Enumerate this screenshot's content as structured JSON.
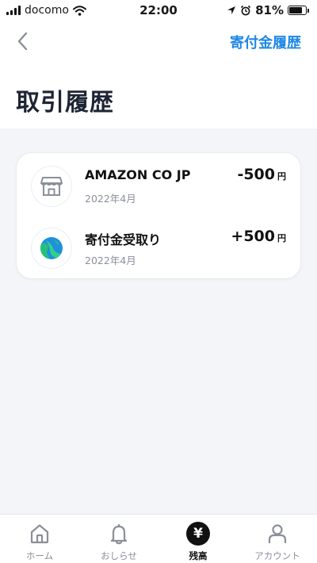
{
  "status_bar": {
    "carrier": "docomo",
    "time": "22:00",
    "battery": "81%",
    "battery_level": 0.81
  },
  "header": {
    "title": "取引履歴",
    "donation_link": "寄付金履歴"
  },
  "transactions": [
    {
      "name": "AMAZON CO JP",
      "date": "2022年4月",
      "amount": "-500",
      "unit": "円",
      "icon": "store-icon"
    },
    {
      "name": "寄付金受取り",
      "date": "2022年4月",
      "amount": "+500",
      "unit": "円",
      "icon": "globe-leaf-icon"
    }
  ],
  "tabs": [
    {
      "label": "ホーム",
      "icon": "home-icon"
    },
    {
      "label": "おしらせ",
      "icon": "bell-icon"
    },
    {
      "label": "残高",
      "icon": "yen-icon",
      "glyph": "¥",
      "active": true
    },
    {
      "label": "アカウント",
      "icon": "person-icon"
    }
  ],
  "colors": {
    "accent": "#1e88e5",
    "background": "#f4f5f9",
    "title": "#1d2433",
    "muted": "#8a8f99"
  }
}
